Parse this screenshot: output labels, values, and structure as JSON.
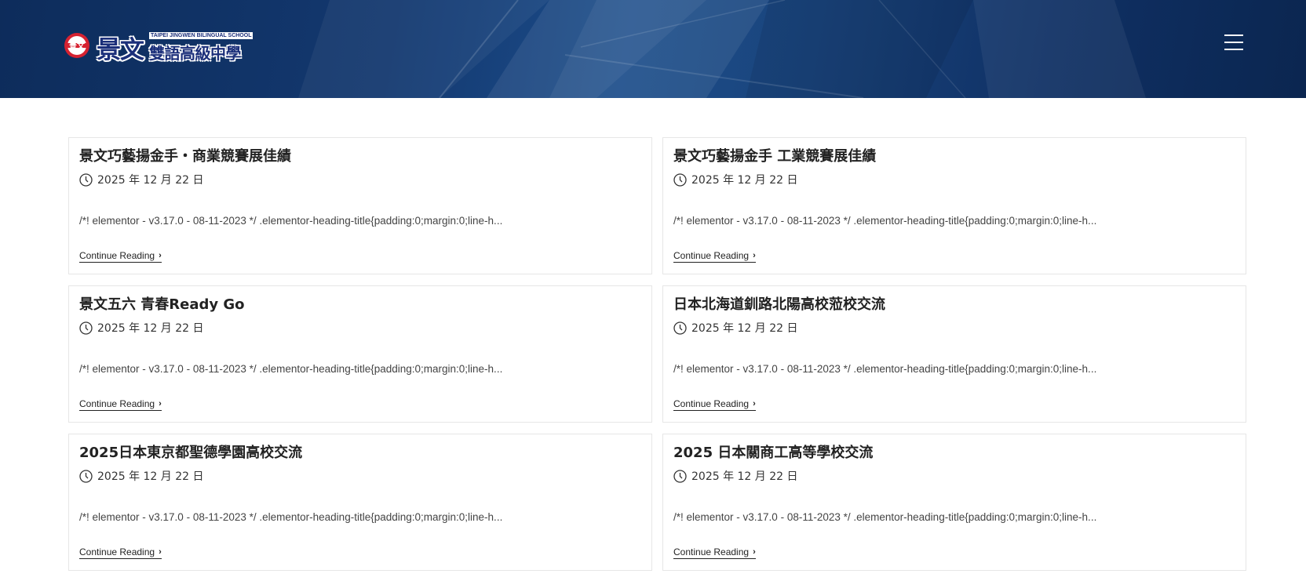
{
  "header": {
    "logo_cn": "景文",
    "logo_en": "TAIPEI JINGWEN BILINGUAL SCHOOL",
    "logo_sub": "雙語高級中學",
    "logo_mark_text": "景文",
    "menu_icon": "hamburger-menu-icon"
  },
  "posts": [
    {
      "title": "景文巧藝揚金手・商業競賽展佳績",
      "date": "2025 年 12 月 22 日",
      "excerpt": "/*! elementor - v3.17.0 - 08-11-2023 */ .elementor-heading-title{padding:0;margin:0;line-h...",
      "more": "Continue Reading"
    },
    {
      "title": "景文巧藝揚金手 工業競賽展佳績",
      "date": "2025 年 12 月 22 日",
      "excerpt": "/*! elementor - v3.17.0 - 08-11-2023 */ .elementor-heading-title{padding:0;margin:0;line-h...",
      "more": "Continue Reading"
    },
    {
      "title": "景文五六 青春Ready Go",
      "date": "2025 年 12 月 22 日",
      "excerpt": "/*! elementor - v3.17.0 - 08-11-2023 */ .elementor-heading-title{padding:0;margin:0;line-h...",
      "more": "Continue Reading"
    },
    {
      "title": "日本北海道釧路北陽高校蒞校交流",
      "date": "2025 年 12 月 22 日",
      "excerpt": "/*! elementor - v3.17.0 - 08-11-2023 */ .elementor-heading-title{padding:0;margin:0;line-h...",
      "more": "Continue Reading"
    },
    {
      "title": "2025日本東京都聖德學園高校交流",
      "date": "2025 年 12 月 22 日",
      "excerpt": "/*! elementor - v3.17.0 - 08-11-2023 */ .elementor-heading-title{padding:0;margin:0;line-h...",
      "more": "Continue Reading"
    },
    {
      "title": "2025 日本關商工高等學校交流",
      "date": "2025 年 12 月 22 日",
      "excerpt": "/*! elementor - v3.17.0 - 08-11-2023 */ .elementor-heading-title{padding:0;margin:0;line-h...",
      "more": "Continue Reading"
    }
  ]
}
